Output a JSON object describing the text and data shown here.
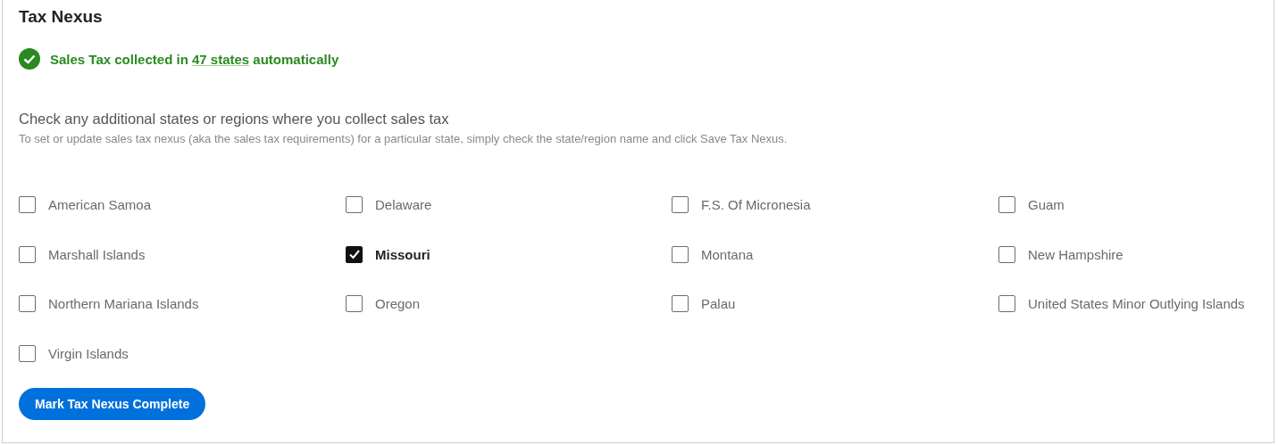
{
  "title": "Tax Nexus",
  "status": {
    "prefix": "Sales Tax collected in ",
    "link": "47 states",
    "suffix": " automatically"
  },
  "instructions": {
    "heading": "Check any additional states or regions where you collect sales tax",
    "detail": "To set or update sales tax nexus (aka the sales tax requirements) for a particular state, simply check the state/region name and click Save Tax Nexus."
  },
  "regions": [
    {
      "label": "American Samoa",
      "checked": false
    },
    {
      "label": "Delaware",
      "checked": false
    },
    {
      "label": "F.S. Of Micronesia",
      "checked": false
    },
    {
      "label": "Guam",
      "checked": false
    },
    {
      "label": "Marshall Islands",
      "checked": false
    },
    {
      "label": "Missouri",
      "checked": true
    },
    {
      "label": "Montana",
      "checked": false
    },
    {
      "label": "New Hampshire",
      "checked": false
    },
    {
      "label": "Northern Mariana Islands",
      "checked": false
    },
    {
      "label": "Oregon",
      "checked": false
    },
    {
      "label": "Palau",
      "checked": false
    },
    {
      "label": "United States Minor Outlying Islands",
      "checked": false
    },
    {
      "label": "Virgin Islands",
      "checked": false
    }
  ],
  "button": "Mark Tax Nexus Complete"
}
